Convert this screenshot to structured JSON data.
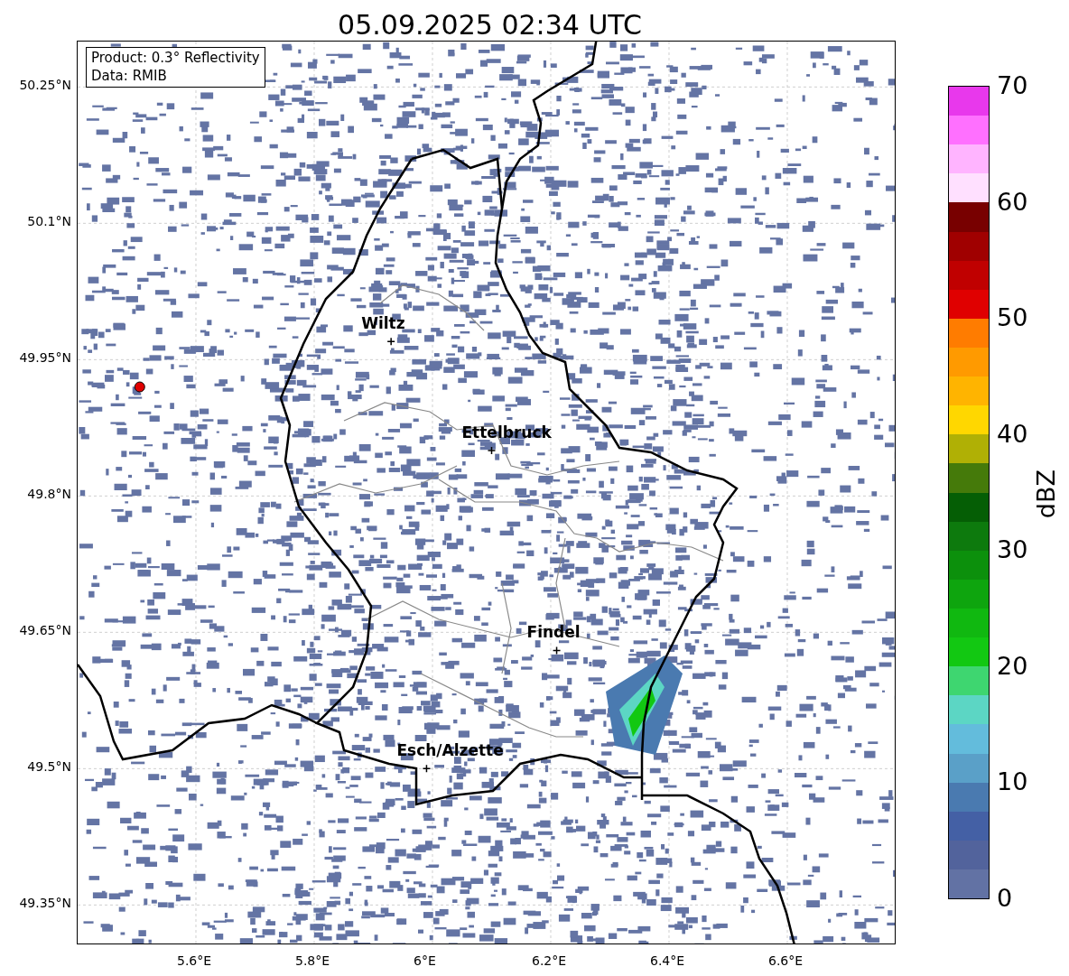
{
  "title": "05.09.2025 02:34 UTC",
  "info_box": [
    "Product: 0.3° Reflectivity",
    "Data: RMIB"
  ],
  "cities": [
    {
      "name": "Wiltz"
    },
    {
      "name": "Ettelbruck"
    },
    {
      "name": "Findel"
    },
    {
      "name": "Esch/Alzette"
    }
  ],
  "lat_ticks": [
    "50.25°N",
    "50.1°N",
    "49.95°N",
    "49.8°N",
    "49.65°N",
    "49.5°N",
    "49.35°N"
  ],
  "lon_ticks": [
    "5.6°E",
    "5.8°E",
    "6°E",
    "6.2°E",
    "6.4°E",
    "6.6°E"
  ],
  "colorbar": {
    "label": "dBZ",
    "ticks": [
      "70",
      "60",
      "50",
      "40",
      "30",
      "20",
      "10",
      "0"
    ],
    "segments": [
      {
        "color": "#e838ec"
      },
      {
        "color": "#ff70ff"
      },
      {
        "color": "#ffb4ff"
      },
      {
        "color": "#ffe0ff"
      },
      {
        "color": "#780000"
      },
      {
        "color": "#a00000"
      },
      {
        "color": "#c00000"
      },
      {
        "color": "#e00000"
      },
      {
        "color": "#ff7c00"
      },
      {
        "color": "#ff9a00"
      },
      {
        "color": "#ffb400"
      },
      {
        "color": "#ffd700"
      },
      {
        "color": "#b0b005"
      },
      {
        "color": "#457a0a"
      },
      {
        "color": "#055e05"
      },
      {
        "color": "#0d7a0d"
      },
      {
        "color": "#0c900c"
      },
      {
        "color": "#0ea50e"
      },
      {
        "color": "#10b810"
      },
      {
        "color": "#12c812"
      },
      {
        "color": "#3ed670"
      },
      {
        "color": "#5cd6c4"
      },
      {
        "color": "#63bcdc"
      },
      {
        "color": "#5aa0c8"
      },
      {
        "color": "#4a7ab0"
      },
      {
        "color": "#4460a5"
      },
      {
        "color": "#52639c"
      },
      {
        "color": "#6272a4"
      }
    ]
  }
}
